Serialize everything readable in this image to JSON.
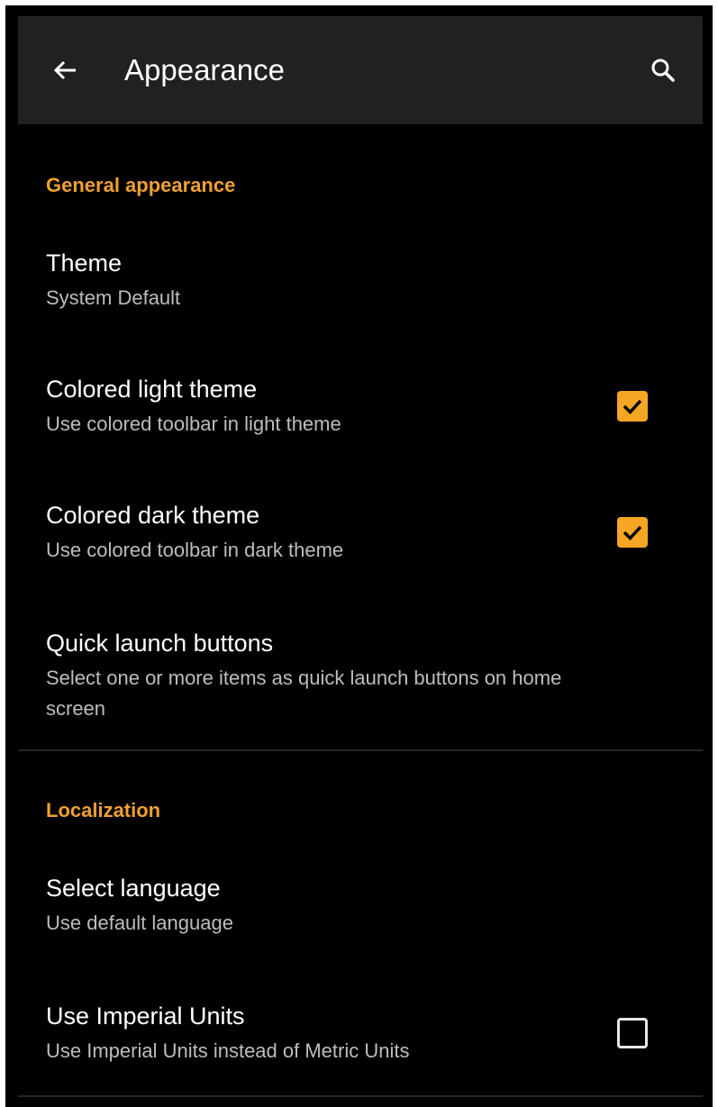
{
  "toolbar": {
    "title": "Appearance",
    "back_icon": "arrow-back-icon",
    "search_icon": "search-icon"
  },
  "sections": [
    {
      "header": "General appearance",
      "items": [
        {
          "title": "Theme",
          "summary": "System Default"
        },
        {
          "title": "Colored light theme",
          "summary": "Use colored toolbar in light theme",
          "checked": true
        },
        {
          "title": "Colored dark theme",
          "summary": "Use colored toolbar in dark theme",
          "checked": true
        },
        {
          "title": "Quick launch buttons",
          "summary": "Select one or more items as quick launch buttons on home screen"
        }
      ]
    },
    {
      "header": "Localization",
      "items": [
        {
          "title": "Select language",
          "summary": "Use default language"
        },
        {
          "title": "Use Imperial Units",
          "summary": "Use Imperial Units instead of Metric Units",
          "checked": false
        }
      ]
    }
  ],
  "colors": {
    "accent": "#f0a030",
    "checkbox_fill": "#f5a623",
    "background": "#000000",
    "toolbar": "#212121"
  }
}
